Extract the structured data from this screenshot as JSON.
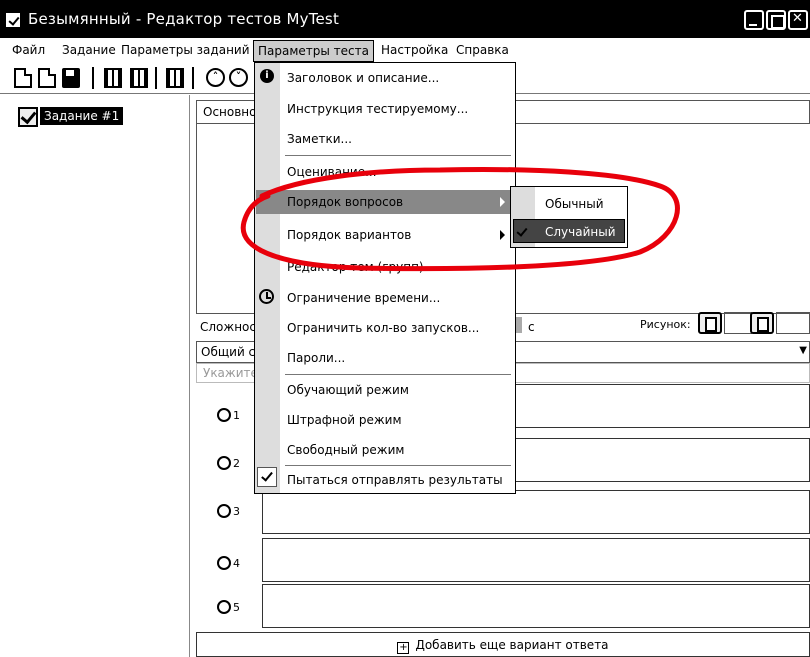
{
  "window": {
    "title": "Безымянный - Редактор тестов MyTest"
  },
  "menubar": {
    "items": [
      {
        "label": "Файл"
      },
      {
        "label": "Задание"
      },
      {
        "label": "Параметры заданий"
      },
      {
        "label": "Параметры теста"
      },
      {
        "label": "Настройка"
      },
      {
        "label": "Справка"
      }
    ]
  },
  "tree": {
    "item_label": "Задание #1"
  },
  "editor": {
    "tab_label": "Основно",
    "complexity_label": "Сложнос",
    "time_unit": "с",
    "picture_label": "Рисунок:",
    "combo_value": "Общий сп",
    "hint": "Укажите",
    "answers": [
      "1",
      "2",
      "3",
      "4",
      "5"
    ],
    "add_answer_label": "Добавить еще вариант ответа"
  },
  "menu": {
    "items": [
      {
        "label": "Заголовок и описание..."
      },
      {
        "label": "Инструкция тестируемому..."
      },
      {
        "label": "Заметки..."
      },
      {
        "label": "Оценивание..."
      },
      {
        "label": "Порядок вопросов"
      },
      {
        "label": "Порядок вариантов"
      },
      {
        "label": "Редактор тем (групп)..."
      },
      {
        "label": "Ограничение времени..."
      },
      {
        "label": "Ограничить кол-во запусков..."
      },
      {
        "label": "Пароли..."
      },
      {
        "label": "Обучающий режим"
      },
      {
        "label": "Штрафной режим"
      },
      {
        "label": "Свободный режим"
      },
      {
        "label": "Пытаться отправлять результаты"
      }
    ]
  },
  "submenu": {
    "items": [
      {
        "label": "Обычный"
      },
      {
        "label": "Случайный"
      }
    ]
  },
  "colors": {
    "annotation": "#e8000b",
    "highlight": "#888888",
    "titlebar": "#000000"
  }
}
